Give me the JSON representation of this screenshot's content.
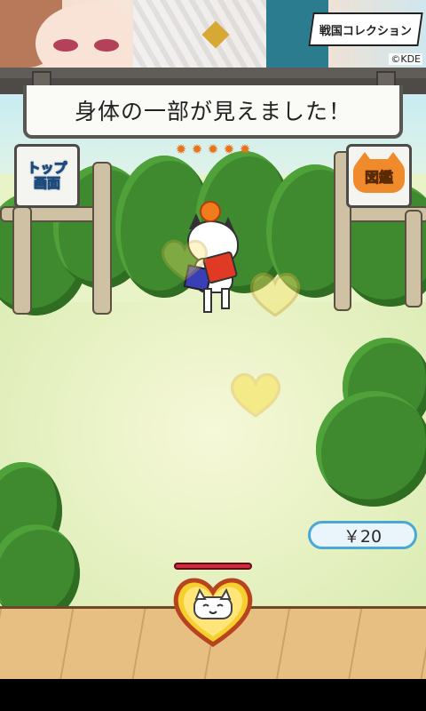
{
  "banner": {
    "logo_text": "戦国コレクション",
    "copyright": "©KDE"
  },
  "message": "身体の一部が見えました！",
  "buttons": {
    "top_line1": "トップ",
    "top_line2": "画面",
    "zukan": "図鑑"
  },
  "stars": [
    "✹",
    "✹",
    "✹",
    "✹",
    "✹"
  ],
  "money": "￥20",
  "hp_level": 1.0,
  "icons": {
    "home": "house-icon",
    "catalog": "cat-icon",
    "hearts": "heart-icon"
  },
  "colors": {
    "accent_blue": "#4aa7d8",
    "hp_red": "#d8273a",
    "heart_yellow": "#f7d94a",
    "bush_green": "#3f8a2e"
  }
}
